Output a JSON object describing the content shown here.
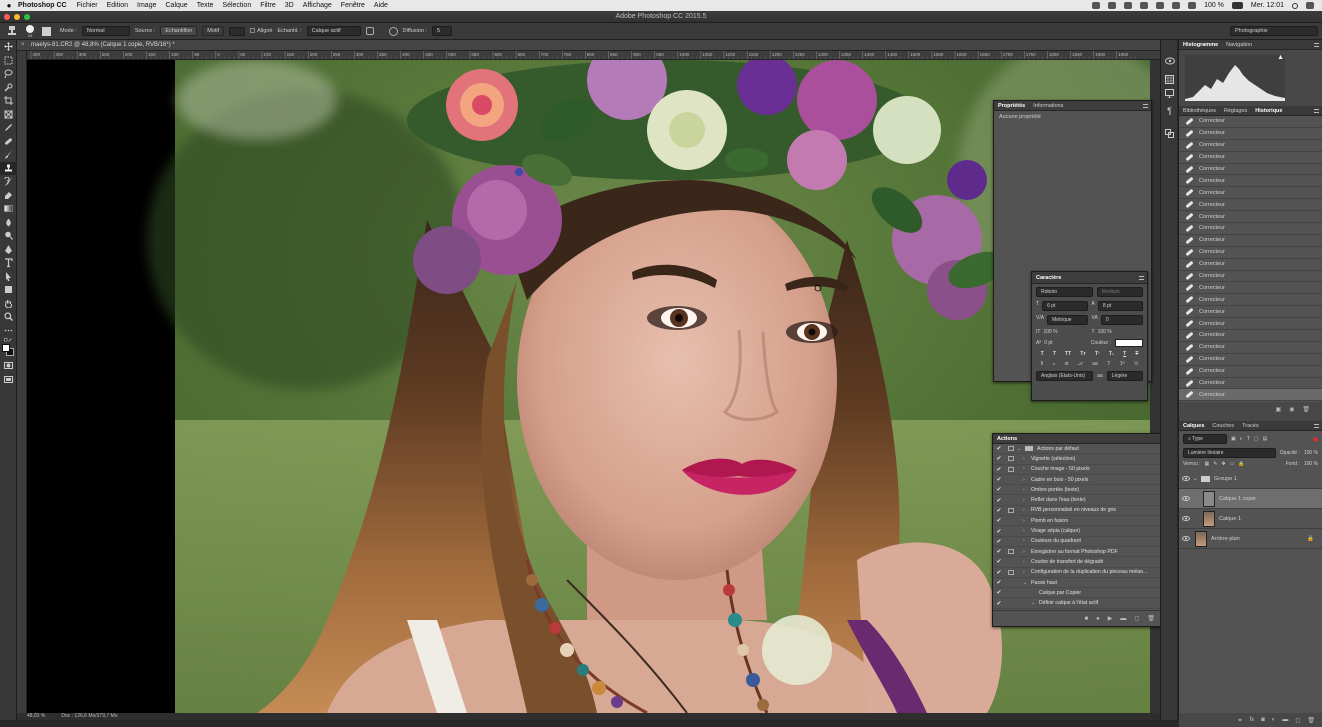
{
  "macbar": {
    "app": "Photoshop CC",
    "menus": [
      "Fichier",
      "Edition",
      "Image",
      "Calque",
      "Texte",
      "Sélection",
      "Filtre",
      "3D",
      "Affichage",
      "Fenêtre",
      "Aide"
    ],
    "battery": "100 %",
    "clock": "Mer. 12:01"
  },
  "window": {
    "title": "Adobe Photoshop CC 2015.5"
  },
  "options": {
    "brush_size": "24",
    "mode_label": "Mode :",
    "mode_value": "Normal",
    "source_label": "Source :",
    "source_sample": "Echantillon",
    "source_pattern": "Motif",
    "aligned_label": "Aligné",
    "sample_label": "Echantil. :",
    "sample_value": "Calque actif",
    "diffusion_label": "Diffusion :",
    "diffusion_value": "5",
    "workspace": "Photographie"
  },
  "document": {
    "tab_title": "maelys-81.CR2 @ 48,8% (Calque 1 copie, RVB/16*) *",
    "ruler_ticks": [
      "400",
      "350",
      "300",
      "250",
      "200",
      "150",
      "100",
      "50",
      "0",
      "50",
      "100",
      "150",
      "200",
      "250",
      "300",
      "350",
      "400",
      "450",
      "500",
      "550",
      "600",
      "650",
      "700",
      "750",
      "800",
      "850",
      "900",
      "950",
      "1000",
      "1050",
      "1100",
      "1150",
      "1200",
      "1250",
      "1300",
      "1350",
      "1400",
      "1450",
      "1500",
      "1550",
      "1600",
      "1650",
      "1700",
      "1750",
      "1800",
      "1850",
      "1900",
      "1950"
    ],
    "zoom": "48,83 %",
    "doc_info": "Doc : 126,6 Mo/379,7 Mo"
  },
  "properties": {
    "tabs": [
      "Propriétés",
      "Informations"
    ],
    "empty_text": "Aucune propriété"
  },
  "character": {
    "title": "Caractère",
    "font": "Roboto",
    "style": "Medium",
    "size": "6 pt",
    "leading": "8 pt",
    "kerning": "Métrique",
    "tracking": "0",
    "vscale": "100 %",
    "hscale": "100 %",
    "baseline": "0 pt",
    "color_label": "Couleur :",
    "color": "#ffffff",
    "language": "Anglais (Etats-Unis)",
    "aa": "aa",
    "smoothing": "Légère"
  },
  "actions": {
    "title": "Actions",
    "items": [
      {
        "label": "Actions par défaut",
        "level": 0,
        "open": true,
        "folder": true,
        "dialog": true
      },
      {
        "label": "Vignette (sélection)",
        "level": 1,
        "open": false,
        "dialog": true
      },
      {
        "label": "Couche image - 50 pixels",
        "level": 1,
        "open": false,
        "dialog": true
      },
      {
        "label": "Cadre en bois - 50 pixels",
        "level": 1,
        "open": false,
        "dialog": false
      },
      {
        "label": "Ombre portée (texte)",
        "level": 1,
        "open": false,
        "dialog": false
      },
      {
        "label": "Reflet dans l'eau (texte)",
        "level": 1,
        "open": false,
        "dialog": false
      },
      {
        "label": "RVB personnalisé en niveaux de gris",
        "level": 1,
        "open": false,
        "dialog": true
      },
      {
        "label": "Plomb en fusion",
        "level": 1,
        "open": false,
        "dialog": false
      },
      {
        "label": "Virage sépia (calque)",
        "level": 1,
        "open": false,
        "dialog": false
      },
      {
        "label": "Couleurs du quadrant",
        "level": 1,
        "open": false,
        "dialog": false
      },
      {
        "label": "Enregistrer au format Photoshop PDF",
        "level": 1,
        "open": false,
        "dialog": true
      },
      {
        "label": "Courbe de transfert de dégradé",
        "level": 1,
        "open": false,
        "dialog": false
      },
      {
        "label": "Configuration de la duplication du pinceau mélan...",
        "level": 1,
        "open": false,
        "dialog": true
      },
      {
        "label": "Passe haut",
        "level": 1,
        "open": true,
        "dialog": false
      },
      {
        "label": "Calque par Copier",
        "level": 2,
        "open": false,
        "dialog": false,
        "noarrow": true
      },
      {
        "label": "Définir calque à l'état actif",
        "level": 2,
        "open": true,
        "dialog": false
      }
    ]
  },
  "dock": {
    "top_tabs": [
      "Histogramme",
      "Navigation"
    ],
    "mid_tabs": [
      "Bibliothèques",
      "Réglages",
      "Historique"
    ],
    "history_items": [
      "Correcteur",
      "Correcteur",
      "Correcteur",
      "Correcteur",
      "Correcteur",
      "Correcteur",
      "Correcteur",
      "Correcteur",
      "Correcteur",
      "Correcteur",
      "Correcteur",
      "Correcteur",
      "Correcteur",
      "Correcteur",
      "Correcteur",
      "Correcteur",
      "Correcteur",
      "Correcteur",
      "Correcteur",
      "Correcteur",
      "Correcteur",
      "Correcteur",
      "Correcteur",
      "Correcteur"
    ],
    "layer_tabs": [
      "Calques",
      "Couches",
      "Tracés"
    ],
    "filter_type": "Type",
    "blend_mode": "Lumière linéaire",
    "opacity_label": "Opacité :",
    "opacity": "100 %",
    "lock_label": "Verrou :",
    "fill_label": "Fond :",
    "fill": "100 %",
    "layers": [
      {
        "name": "Groupe 1",
        "kind": "group",
        "selected": false
      },
      {
        "name": "Calque 1 copie",
        "kind": "gray",
        "selected": true
      },
      {
        "name": "Calque 1",
        "kind": "photo",
        "selected": false
      },
      {
        "name": "Arrière-plan",
        "kind": "photo",
        "selected": false,
        "locked": true
      }
    ]
  }
}
